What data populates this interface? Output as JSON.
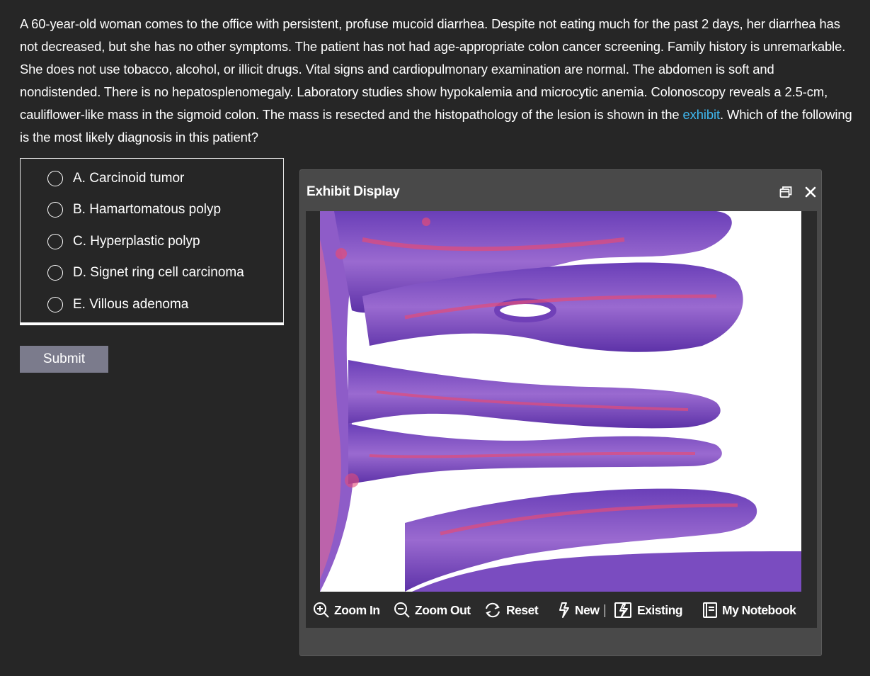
{
  "question": {
    "text_before": "A 60-year-old woman comes to the office with persistent, profuse mucoid diarrhea.  Despite not eating much for the past 2 days, her diarrhea has not decreased, but she has no other symptoms.  The patient has not had age-appropriate colon cancer screening.  Family history is unremarkable.  She does not use tobacco, alcohol, or illicit drugs.  Vital signs and cardiopulmonary examination are normal.  The abdomen is soft and nondistended.  There is no hepatosplenomegaly.  Laboratory studies show hypokalemia and microcytic anemia.  Colonoscopy reveals a 2.5-cm, cauliflower-like mass in the sigmoid colon.  The mass is resected and the histopathology of the lesion is shown in the ",
    "link_text": "exhibit",
    "text_after": ".  Which of the following is the most likely diagnosis in this patient?"
  },
  "choices": [
    {
      "label": "A.  Carcinoid tumor"
    },
    {
      "label": "B.  Hamartomatous polyp"
    },
    {
      "label": "C.  Hyperplastic polyp"
    },
    {
      "label": "D.  Signet ring cell carcinoma"
    },
    {
      "label": "E.  Villous adenoma"
    }
  ],
  "submit_label": "Submit",
  "exhibit": {
    "title": "Exhibit Display",
    "toolbar": {
      "zoom_in": "Zoom In",
      "zoom_out": "Zoom Out",
      "reset": "Reset",
      "new": "New",
      "existing": "Existing",
      "notebook": "My Notebook"
    }
  },
  "icons": {
    "zoom_in": "magnifier-plus-icon",
    "zoom_out": "magnifier-minus-icon",
    "reset": "refresh-icon",
    "new": "flashcard-icon",
    "existing": "flashcard-box-icon",
    "notebook": "notebook-icon",
    "restore": "window-restore-icon",
    "close": "close-icon"
  },
  "colors": {
    "background": "#262626",
    "panel": "#494949",
    "link": "#3fb8f0",
    "submit": "#7b7b8c"
  }
}
